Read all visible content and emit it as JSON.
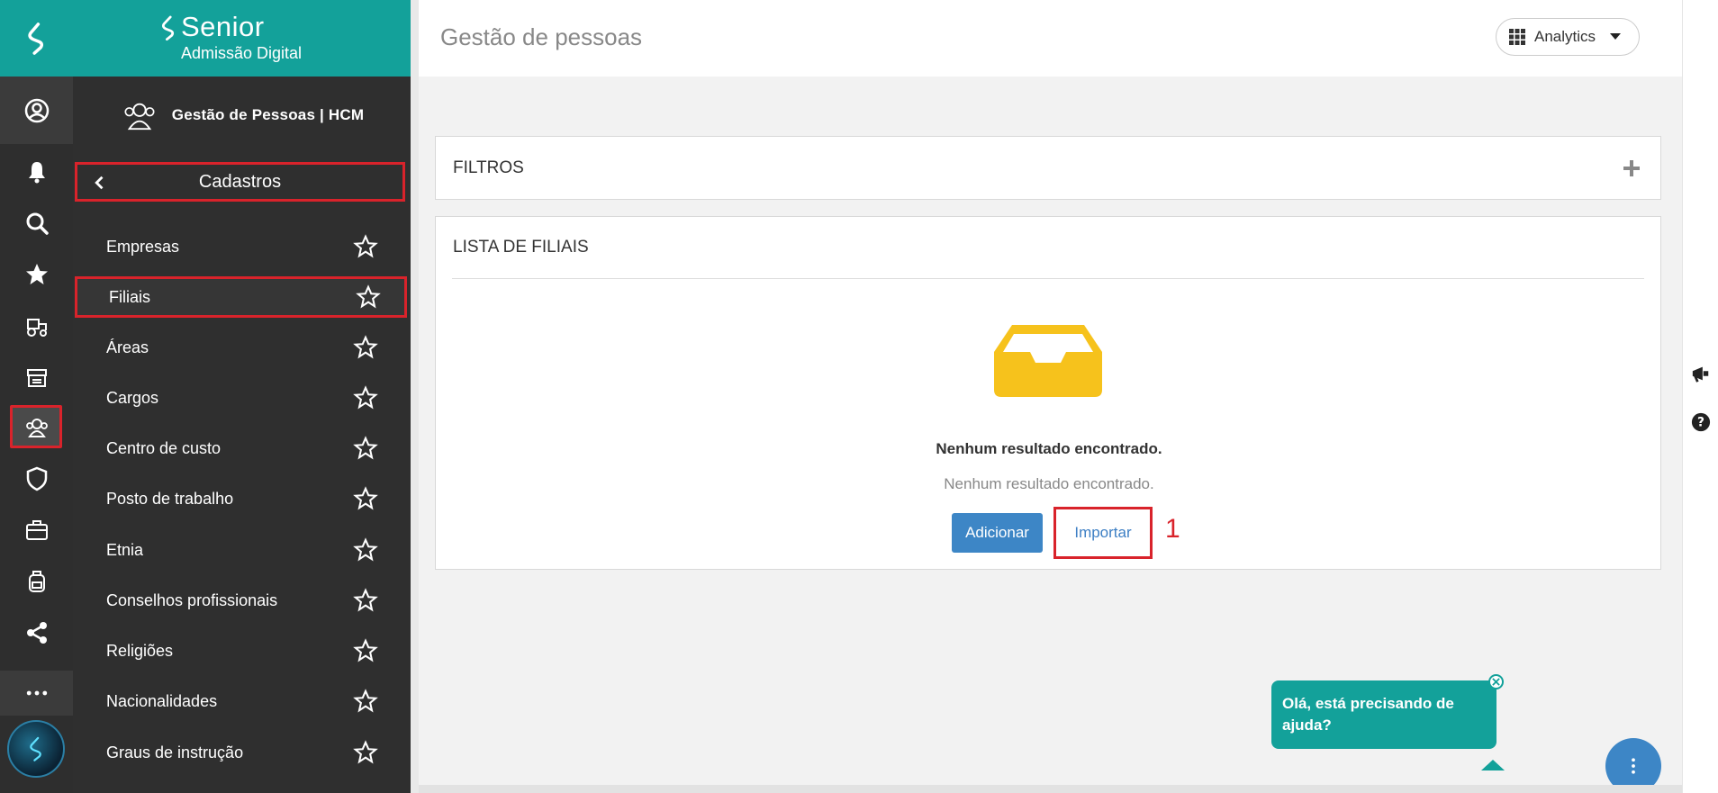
{
  "brand": {
    "name": "Senior",
    "subtitle": "Admissão Digital"
  },
  "module": {
    "label": "Gestão de Pessoas | HCM"
  },
  "section": {
    "label": "Cadastros"
  },
  "menu": {
    "items": [
      {
        "label": "Empresas"
      },
      {
        "label": "Filiais"
      },
      {
        "label": "Áreas"
      },
      {
        "label": "Cargos"
      },
      {
        "label": "Centro de custo"
      },
      {
        "label": "Posto de trabalho"
      },
      {
        "label": "Etnia"
      },
      {
        "label": "Conselhos profissionais"
      },
      {
        "label": "Religiões"
      },
      {
        "label": "Nacionalidades"
      },
      {
        "label": "Graus de instrução"
      }
    ],
    "selected": "Filiais"
  },
  "header": {
    "title": "Gestão de pessoas",
    "analytics_label": "Analytics"
  },
  "filters": {
    "title": "FILTROS"
  },
  "list": {
    "title": "LISTA DE FILIAIS",
    "empty_title": "Nenhum resultado encontrado.",
    "empty_subtitle": "Nenhum resultado encontrado.",
    "add_label": "Adicionar",
    "import_label": "Importar",
    "annotation": "1"
  },
  "help": {
    "message": "Olá, está precisando de ajuda?"
  },
  "colors": {
    "teal": "#13a19a",
    "red_highlight": "#d9232b",
    "primary_blue": "#3d86c6",
    "empty_icon": "#f6c21c"
  }
}
